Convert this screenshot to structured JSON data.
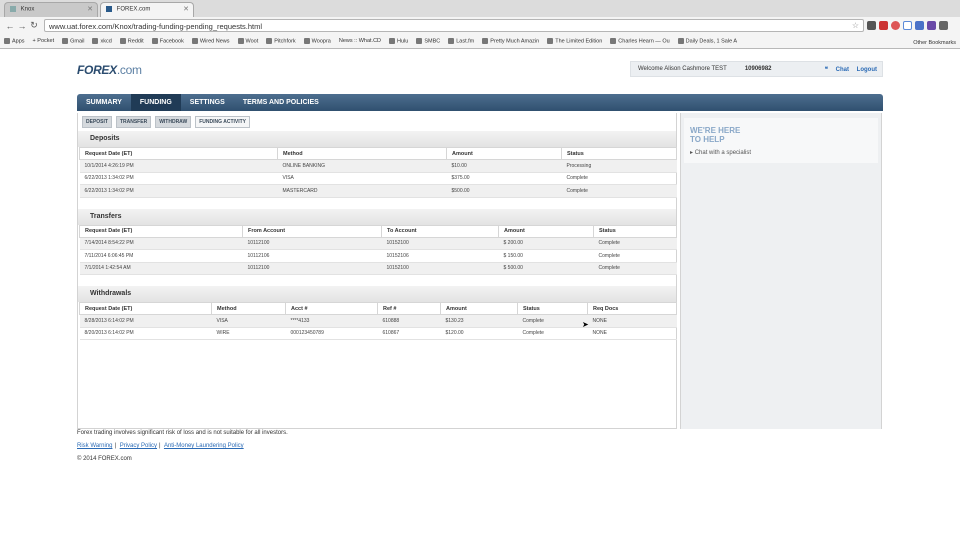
{
  "browser": {
    "tabs": [
      {
        "label": "Knox",
        "active": false
      },
      {
        "label": "FOREX.com",
        "active": true
      }
    ],
    "url": "www.uat.forex.com/Knox/trading-funding-pending_requests.html",
    "bookmarks": [
      "Apps",
      "+ Pocket",
      "Gmail",
      "xkcd",
      "Reddit",
      "Facebook",
      "Wired News",
      "Woot",
      "Pitchfork",
      "Woopra",
      "News :: What.CD",
      "Hulu",
      "SMBC",
      "Last.fm",
      "Pretty Much Amazin",
      "The Limited Edition",
      "Charles Hearn — Ou",
      "Daily Deals, 1 Sale A"
    ],
    "other_bookmarks": "Other Bookmarks"
  },
  "header": {
    "logo": "FOREX",
    "logo_suffix": ".com",
    "welcome": "Welcome Alison Cashmore TEST",
    "account_number": "10906982",
    "chat_link": "Chat",
    "logout_link": "Logout"
  },
  "main_nav": [
    {
      "label": "SUMMARY",
      "active": false
    },
    {
      "label": "FUNDING",
      "active": true
    },
    {
      "label": "SETTINGS",
      "active": false
    },
    {
      "label": "TERMS AND POLICIES",
      "active": false
    }
  ],
  "sub_nav": [
    {
      "label": "DEPOSIT",
      "active": false
    },
    {
      "label": "TRANSFER",
      "active": false
    },
    {
      "label": "WITHDRAW",
      "active": false
    },
    {
      "label": "FUNDING ACTIVITY",
      "active": true
    }
  ],
  "deposits": {
    "title": "Deposits",
    "columns": [
      "Request Date (ET)",
      "Method",
      "Amount",
      "Status"
    ],
    "rows": [
      [
        "10/1/2014 4:26:19 PM",
        "ONLINE BANKING",
        "$10.00",
        "Processing"
      ],
      [
        "6/22/2013 1:34:02 PM",
        "VISA",
        "$375.00",
        "Complete"
      ],
      [
        "6/22/2013 1:34:02 PM",
        "MASTERCARD",
        "$500.00",
        "Complete"
      ]
    ]
  },
  "transfers": {
    "title": "Transfers",
    "columns": [
      "Request Date (ET)",
      "From Account",
      "To Account",
      "Amount",
      "Status"
    ],
    "rows": [
      [
        "7/14/2014 8:54:22 PM",
        "10112100",
        "10152100",
        "$ 200.00",
        "Complete"
      ],
      [
        "7/11/2014 6:06:45 PM",
        "10112106",
        "10152106",
        "$ 150.00",
        "Complete"
      ],
      [
        "7/1/2014 1:42:54 AM",
        "10112100",
        "10152100",
        "$ 500.00",
        "Complete"
      ]
    ]
  },
  "withdrawals": {
    "title": "Withdrawals",
    "columns": [
      "Request Date (ET)",
      "Method",
      "Acct #",
      "Ref #",
      "Amount",
      "Status",
      "Req Docs"
    ],
    "rows": [
      [
        "8/28/2013 6:14:02 PM",
        "VISA",
        "****4133",
        "610888",
        "$130.23",
        "Complete",
        "NONE"
      ],
      [
        "8/20/2013 6:14:02 PM",
        "WIRE",
        "000123450789",
        "610867",
        "$120.00",
        "Complete",
        "NONE"
      ]
    ]
  },
  "sidebar": {
    "help_title_1": "WE'RE HERE",
    "help_title_2": "TO HELP",
    "chat_label": "Chat with a specialist"
  },
  "footer": {
    "disclaimer": "Forex trading involves significant risk of loss and is not suitable for all investors.",
    "links": [
      "Risk Warning",
      "Privacy Policy",
      "Anti-Money Laundering Policy"
    ],
    "copyright": "© 2014 FOREX.com"
  },
  "colors": {
    "nav_blue": "#30506f",
    "link_blue": "#2a6ab5",
    "help_blue": "#8aa8c8"
  }
}
